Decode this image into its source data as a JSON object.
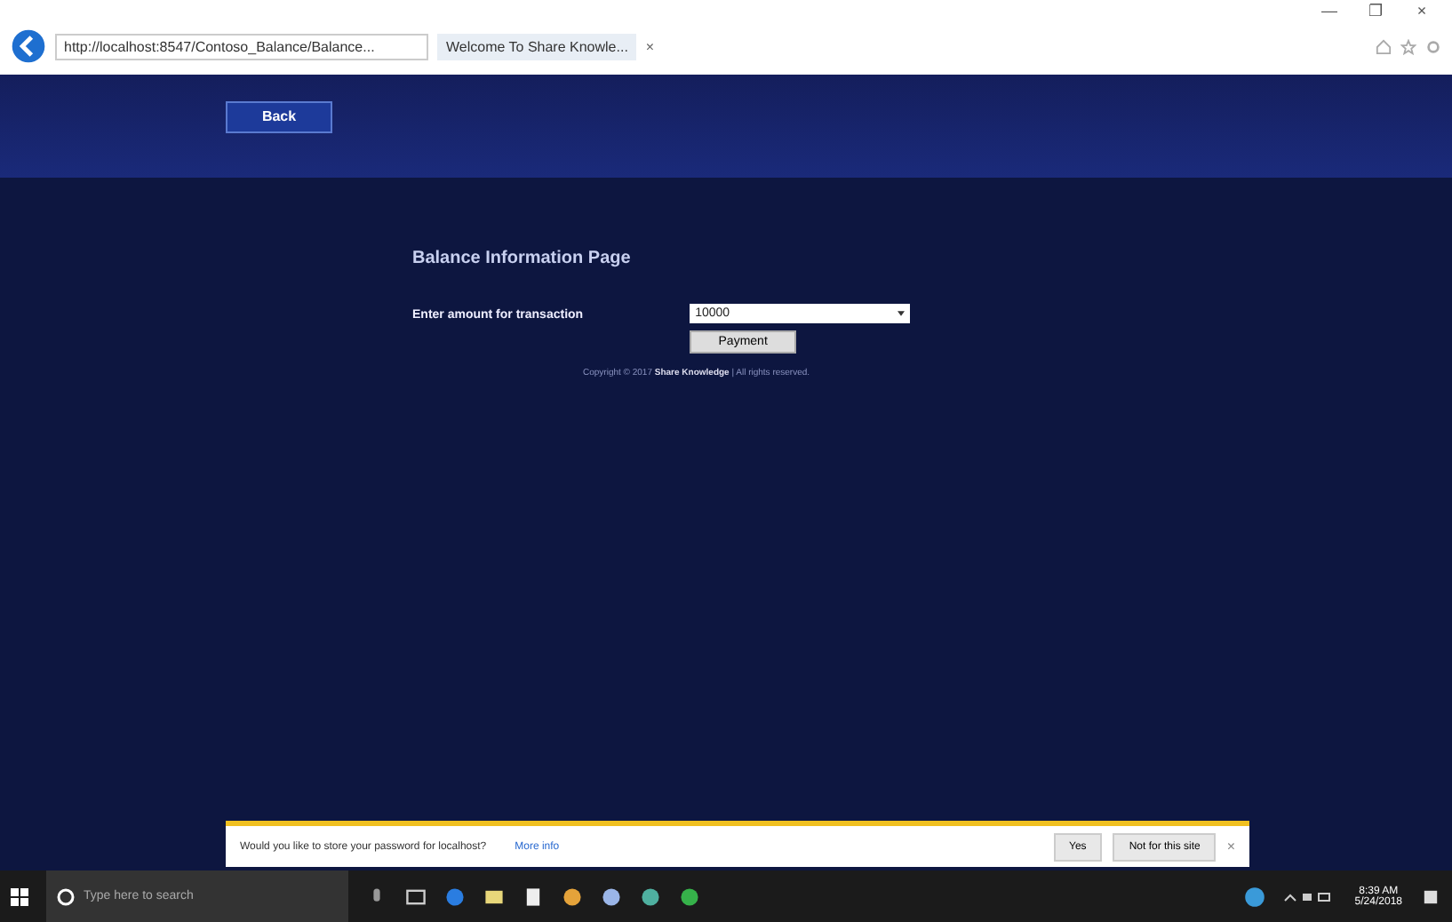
{
  "browser": {
    "address": "http://localhost:8547/Contoso_Balance/Balance...",
    "tab_title": "Welcome To Share Knowle...",
    "tab_close": "×",
    "window_controls": [
      "—",
      "❐",
      "×"
    ]
  },
  "page": {
    "back_button": "Back",
    "heading": "Balance Information Page",
    "amount_label": "Enter amount for transaction",
    "amount_value": "10000",
    "payment_button": "Payment",
    "footer_prefix": "Copyright © 2017",
    "footer_brand": "Share Knowledge",
    "footer_suffix": "| All rights reserved."
  },
  "password_bar": {
    "message": "Would you like to store your password for localhost?",
    "link": "More info",
    "buttons": [
      "Yes",
      "Not for this site"
    ],
    "close": "×"
  },
  "taskbar": {
    "search_placeholder": "Type here to search",
    "time": "8:39 AM",
    "date": "5/24/2018"
  }
}
